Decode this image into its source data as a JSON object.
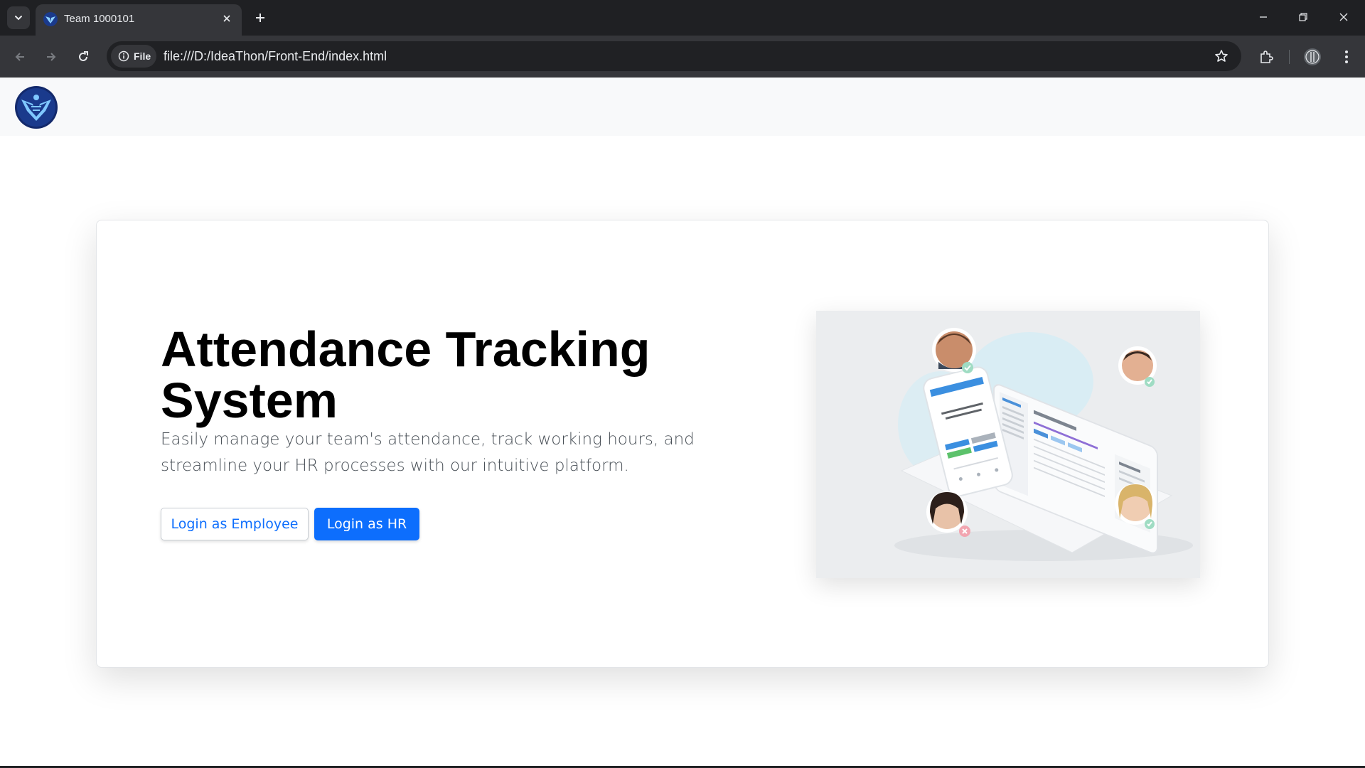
{
  "browser": {
    "tab_title": "Team 1000101",
    "site_chip_label": "File",
    "url": "file:///D:/IdeaThon/Front-End/index.html"
  },
  "hero": {
    "title": "Attendance Tracking System",
    "subtitle": "Easily manage your team's attendance, track working hours, and streamline your HR processes with our intuitive platform.",
    "employee_button": "Login as Employee",
    "hr_button": "Login as HR"
  },
  "colors": {
    "primary": "#0d6efd",
    "navbar_bg": "#f8f9fa",
    "chrome_dark": "#1f2023",
    "chrome_toolbar": "#35363a"
  }
}
